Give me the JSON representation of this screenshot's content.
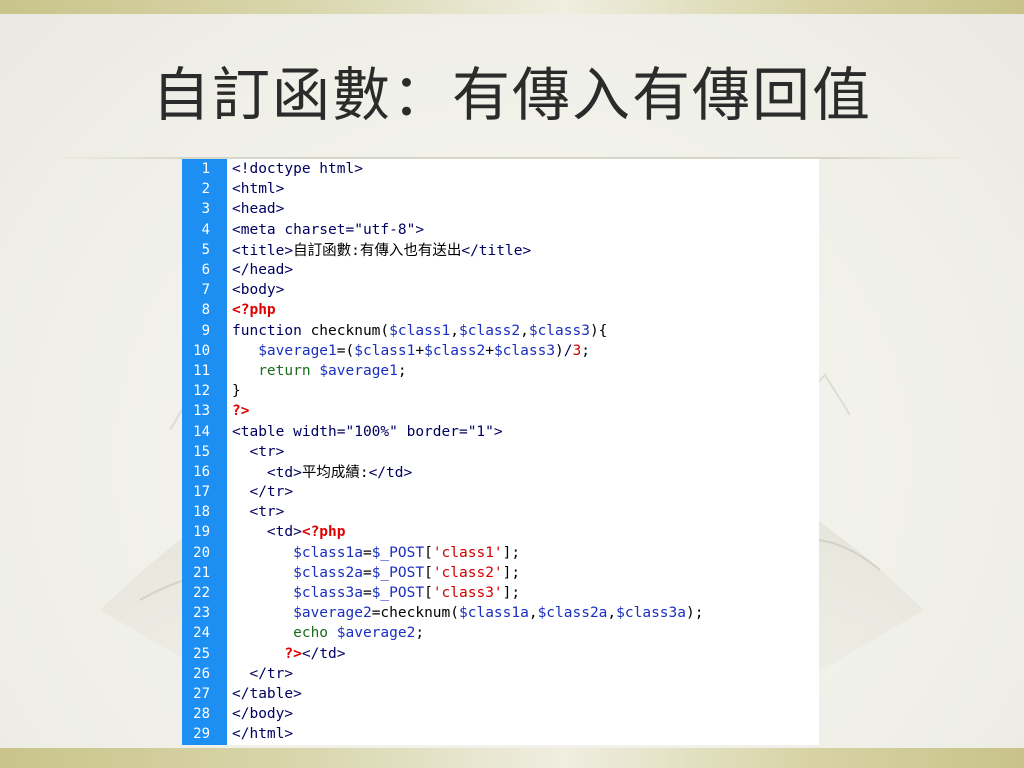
{
  "title": "自訂函數：有傳入有傳回值",
  "code": {
    "line_numbers": [
      "1",
      "2",
      "3",
      "4",
      "5",
      "6",
      "7",
      "8",
      "9",
      "10",
      "11",
      "12",
      "13",
      "14",
      "15",
      "16",
      "17",
      "18",
      "19",
      "20",
      "21",
      "22",
      "23",
      "24",
      "25",
      "26",
      "27",
      "28",
      "29"
    ],
    "lines": [
      "<!doctype html>",
      "<html>",
      "<head>",
      "<meta charset=\"utf-8\">",
      "<title>自訂函數:有傳入也有送出</title>",
      "</head>",
      "<body>",
      "<?php",
      "function checknum($class1,$class2,$class3){",
      "   $average1=($class1+$class2+$class3)/3;",
      "   return $average1;",
      "}",
      "?>",
      "<table width=\"100%\" border=\"1\">",
      "  <tr>",
      "    <td>平均成績:</td>",
      "  </tr>",
      "  <tr>",
      "    <td><?php",
      "       $class1a=$_POST['class1'];",
      "       $class2a=$_POST['class2'];",
      "       $class3a=$_POST['class3'];",
      "       $average2=checknum($class1a,$class2a,$class3a);",
      "       echo $average2;",
      "      ?></td>",
      "  </tr>",
      "</table>",
      "</body>",
      "</html>"
    ]
  },
  "colors": {
    "gutter": "#1d8ff3",
    "php_tag": "#e00000",
    "variable": "#1a2fbf",
    "markup": "#000060"
  }
}
